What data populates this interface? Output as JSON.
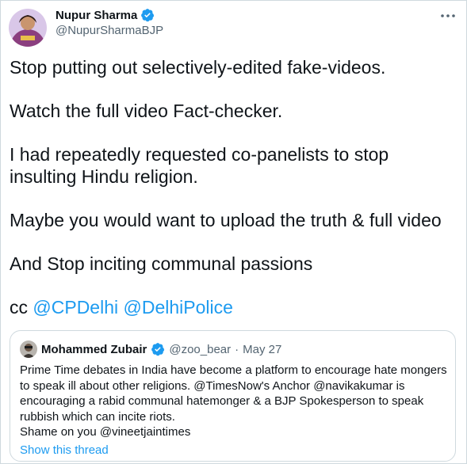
{
  "author": {
    "name": "Nupur Sharma",
    "handle": "@NupurSharmaBJP"
  },
  "tweet": {
    "paragraphs": [
      "Stop putting out selectively-edited fake-videos.",
      "Watch the full video Fact-checker.",
      "I had repeatedly requested co-panelists to stop insulting Hindu religion.",
      "Maybe you would want to upload the truth & full video",
      "And Stop inciting communal passions"
    ],
    "cc_prefix": "cc",
    "mentions": [
      "@CPDelhi",
      "@DelhiPolice"
    ]
  },
  "quoted": {
    "name": "Mohammed Zubair",
    "handle": "@zoo_bear",
    "separator": "·",
    "date": "May 27",
    "text_line1": "Prime Time debates in India have become a platform to encourage hate mongers to speak ill about other religions. @TimesNow's Anchor @navikakumar is encouraging a rabid communal hatemonger & a BJP Spokesperson to speak rubbish which can incite riots.",
    "text_line2": "Shame on you @vineetjaintimes",
    "show_thread": "Show this thread"
  },
  "colors": {
    "accent": "#1d9bf0",
    "secondary_text": "#536471",
    "border": "#cfd9de"
  },
  "icons": {
    "verified": "verified-badge-icon",
    "more": "more-options-icon"
  }
}
